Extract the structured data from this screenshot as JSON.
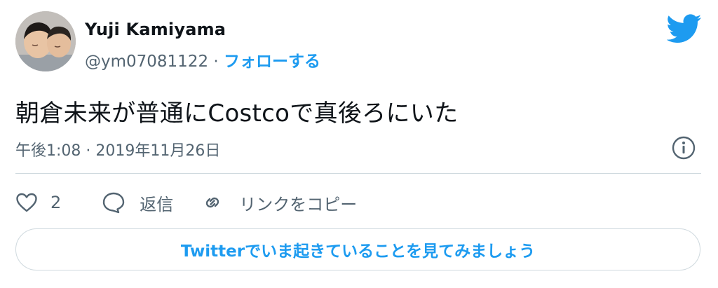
{
  "author": {
    "name": "Yuji Kamiyama",
    "handle": "@ym07081122",
    "separator": "·",
    "follow_label": "フォローする"
  },
  "icons": {
    "brand": "twitter-bird-icon",
    "info": "info-icon",
    "like": "heart-icon",
    "reply": "reply-bubble-icon",
    "copy_link": "link-icon"
  },
  "tweet": {
    "text": "朝倉未来が普通にCostcoで真後ろにいた",
    "timestamp": "午後1:08 · 2019年11月26日"
  },
  "actions": {
    "like_count": "2",
    "reply_label": "返信",
    "copy_link_label": "リンクをコピー"
  },
  "cta": {
    "label": "Twitterでいま起きていることを見てみましょう"
  },
  "colors": {
    "accent": "#1d9bf0",
    "text": "#0f1419",
    "secondary_text": "#536471",
    "border": "#cfd9de"
  }
}
